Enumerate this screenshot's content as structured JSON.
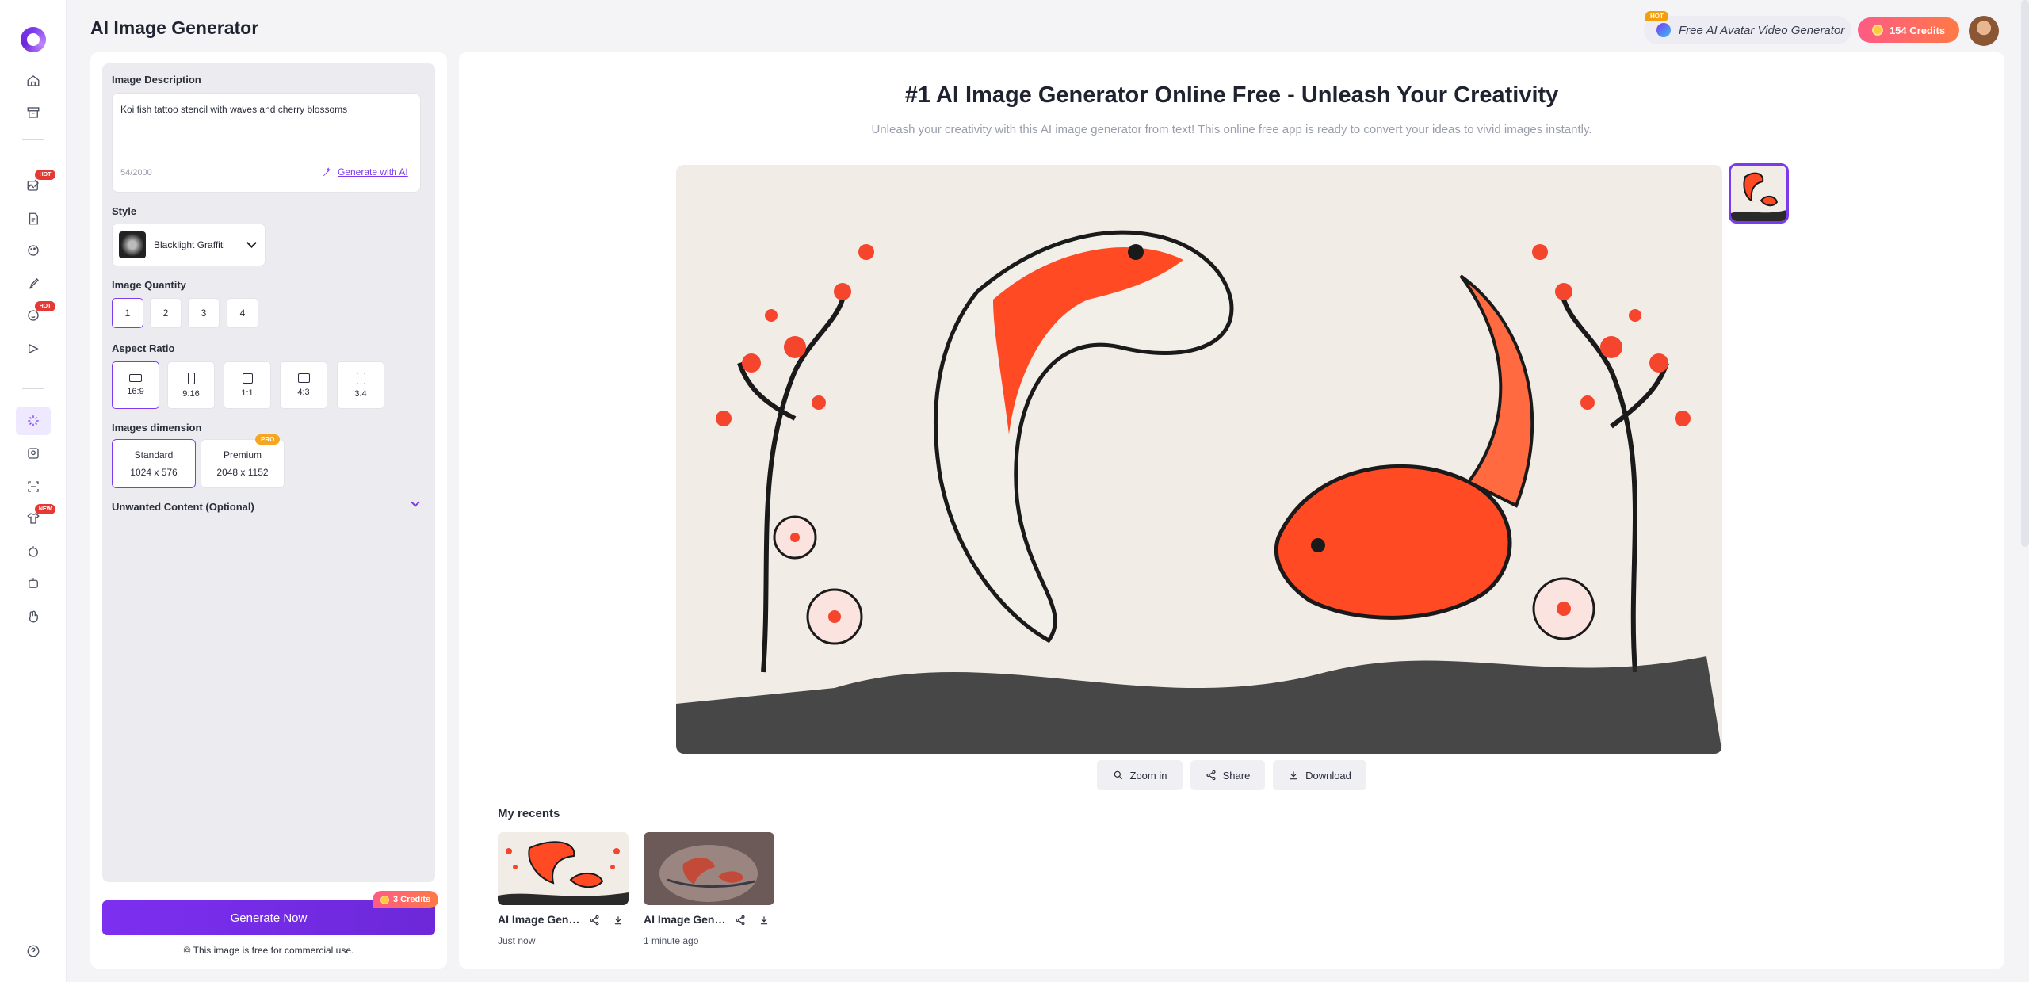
{
  "app": {
    "title": "AI Image Generator"
  },
  "header": {
    "promo_badge": "HOT",
    "promo_label": "Free AI Avatar Video Generator",
    "credits_label": "154 Credits"
  },
  "sidebar": {
    "badges": {
      "hot": "HOT",
      "new": "NEW"
    }
  },
  "form": {
    "description_label": "Image Description",
    "description_value": "Koi fish tattoo stencil with waves and cherry blossoms",
    "char_count": "54/2000",
    "generate_with_ai": "Generate with AI",
    "style_label": "Style",
    "style_value": "Blacklight Graffiti",
    "quantity_label": "Image Quantity",
    "quantities": [
      "1",
      "2",
      "3",
      "4"
    ],
    "aspect_label": "Aspect Ratio",
    "aspects": [
      "16:9",
      "9:16",
      "1:1",
      "4:3",
      "3:4"
    ],
    "dimension_label": "Images dimension",
    "dimensions": [
      {
        "name": "Standard",
        "size": "1024 x 576"
      },
      {
        "name": "Premium",
        "size": "2048 x 1152"
      }
    ],
    "pro_badge": "PRO",
    "unwanted_label": "Unwanted Content (Optional)",
    "generate_button": "Generate Now",
    "generate_cost": "3 Credits",
    "free_note": "This image is free for commercial use."
  },
  "main": {
    "title": "#1 AI Image Generator Online Free - Unleash Your Creativity",
    "subtitle": "Unleash your creativity with this AI image generator from text! This online free app is ready to convert your ideas to vivid images instantly.",
    "actions": {
      "zoom": "Zoom in",
      "share": "Share",
      "download": "Download"
    },
    "recents_title": "My recents",
    "recents": [
      {
        "name": "AI Image Generator",
        "time": "Just now"
      },
      {
        "name": "AI Image Generator",
        "time": "1 minute ago"
      }
    ]
  },
  "colors": {
    "accent": "#7c3aed",
    "credits_gradient_start": "#ff5a86",
    "credits_gradient_end": "#ff7a45"
  }
}
